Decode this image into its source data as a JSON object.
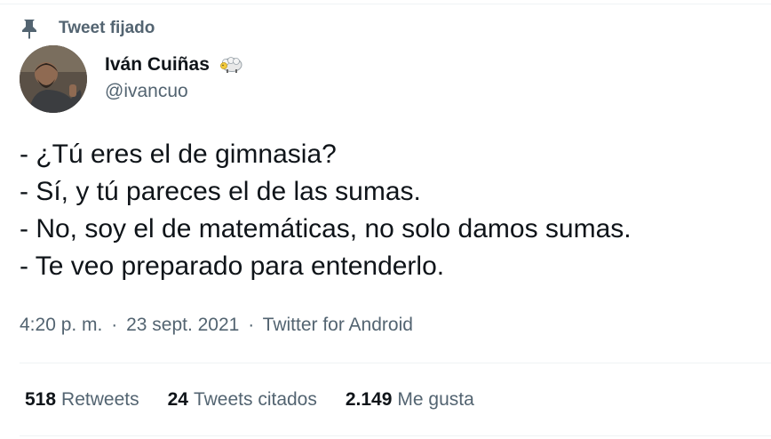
{
  "pinned": {
    "icon": "pin-icon",
    "label": "Tweet fijado"
  },
  "author": {
    "display_name": "Iván Cuiñas",
    "badge_icon": "sheep-emoji-icon",
    "handle": "@ivancuo"
  },
  "tweet": {
    "lines": [
      "- ¿Tú eres el de gimnasia?",
      "- Sí, y tú pareces el de las sumas.",
      "- No, soy el de matemáticas, no solo damos sumas.",
      "- Te veo preparado para entenderlo."
    ]
  },
  "meta": {
    "time": "4:20 p. m.",
    "separator": "·",
    "date": "23 sept. 2021",
    "source": "Twitter for Android"
  },
  "stats": {
    "retweets_count": "518",
    "retweets_label": "Retweets",
    "quotes_count": "24",
    "quotes_label": "Tweets citados",
    "likes_count": "2.149",
    "likes_label": "Me gusta"
  },
  "colors": {
    "text_primary": "#0f1419",
    "text_secondary": "#536471",
    "border": "#eff3f4"
  }
}
